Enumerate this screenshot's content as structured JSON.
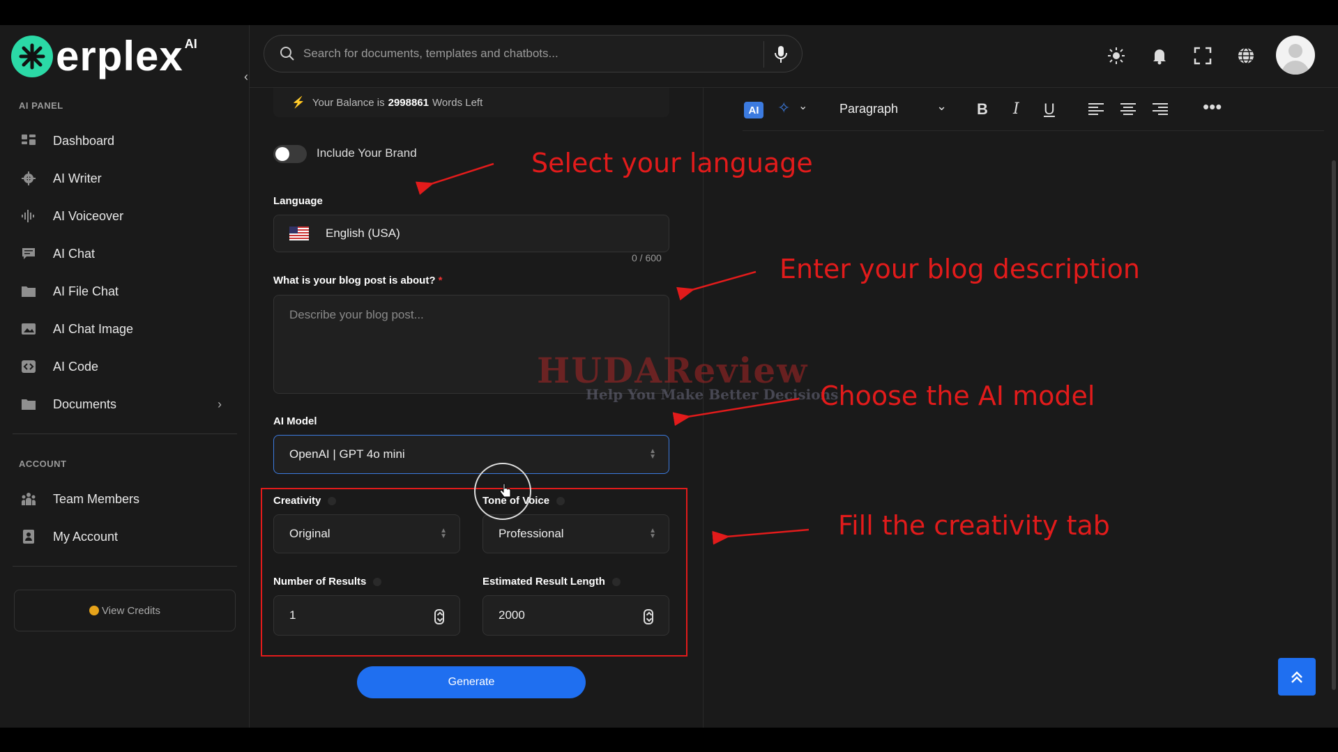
{
  "logo": {
    "text": "erplex",
    "ai": "AI"
  },
  "sidebar": {
    "panel_label": "AI PANEL",
    "items": [
      {
        "label": "Dashboard",
        "icon": "dashboard-icon"
      },
      {
        "label": "AI Writer",
        "icon": "gear-icon"
      },
      {
        "label": "AI Voiceover",
        "icon": "waveform-icon"
      },
      {
        "label": "AI Chat",
        "icon": "chat-icon"
      },
      {
        "label": "AI File Chat",
        "icon": "folder-icon"
      },
      {
        "label": "AI Chat Image",
        "icon": "image-icon"
      },
      {
        "label": "AI Code",
        "icon": "code-icon"
      },
      {
        "label": "Documents",
        "icon": "folder-icon"
      }
    ],
    "account_label": "ACCOUNT",
    "account_items": [
      {
        "label": "Team Members",
        "icon": "team-icon"
      },
      {
        "label": "My Account",
        "icon": "account-icon"
      }
    ],
    "credits_label": "View Credits"
  },
  "search": {
    "placeholder": "Search for documents, templates and chatbots..."
  },
  "form": {
    "balance_prefix": "Your Balance is",
    "balance_value": "2998861",
    "balance_suffix": "Words Left",
    "brand_toggle_label": "Include Your Brand",
    "language_label": "Language",
    "language_value": "English (USA)",
    "blog_label": "What is your blog post is about?",
    "blog_required": "*",
    "blog_counter": "0 / 600",
    "blog_placeholder": "Describe your blog post...",
    "model_label": "AI Model",
    "model_value": "OpenAI | GPT 4o mini",
    "creativity_label": "Creativity",
    "creativity_value": "Original",
    "tone_label": "Tone of Voice",
    "tone_value": "Professional",
    "results_label": "Number of Results",
    "results_value": "1",
    "length_label": "Estimated Result Length",
    "length_value": "2000",
    "generate_label": "Generate"
  },
  "editor": {
    "ai_chip": "AI",
    "format_value": "Paragraph"
  },
  "annotations": {
    "language": "Select your language",
    "description": "Enter your blog description",
    "model": "Choose the AI model",
    "creativity": "Fill the creativity tab"
  },
  "watermark": {
    "title": "HUDAReview",
    "tagline": "Help You Make Better Decisions"
  },
  "colors": {
    "accent": "#1f6ff0",
    "annotation": "#e21b1b",
    "background": "#1a1a1a"
  }
}
